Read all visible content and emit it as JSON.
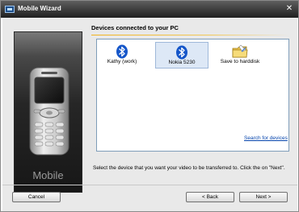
{
  "window": {
    "title": "Mobile Wizard",
    "close_glyph": "✕"
  },
  "left_panel": {
    "brand": "Mobile",
    "image": "mobile-phone-illustration"
  },
  "main": {
    "heading": "Devices connected to your PC",
    "devices": [
      {
        "label": "Kathy (work)",
        "icon": "bluetooth-icon",
        "selected": false
      },
      {
        "label": "Nokia 5230",
        "icon": "bluetooth-icon",
        "selected": true
      },
      {
        "label": "Save to harddisk",
        "icon": "folder-icon",
        "selected": false
      }
    ],
    "search_link": "Search for devices",
    "instruction": "Select the device that you want your video to be transferred to. Click the on \"Next\"."
  },
  "footer": {
    "cancel_label": "Cancel",
    "back_label": "< Back",
    "next_label": "Next >"
  },
  "colors": {
    "titlebar": "#2b2b2b",
    "accent_rule": "#f1b320",
    "link": "#0645ad",
    "bluetooth": "#1556c9",
    "selection": "#dde8f6"
  }
}
